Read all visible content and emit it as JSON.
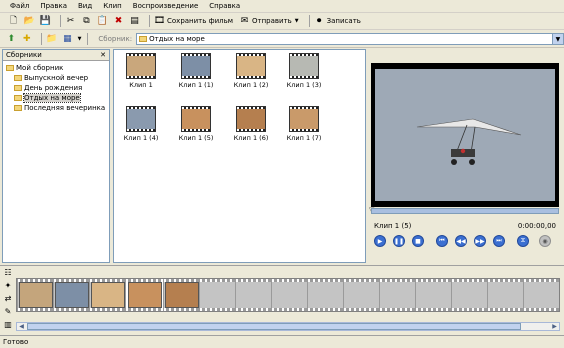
{
  "menu": [
    "Файл",
    "Правка",
    "Вид",
    "Клип",
    "Воспроизведение",
    "Справка"
  ],
  "toolbar": {
    "save_movie": "Сохранить фильм",
    "send": "Отправить",
    "record": "Записать"
  },
  "collections_bar": {
    "label": "Сборник:",
    "selected": "Отдых на море"
  },
  "left_panel": {
    "title": "Сборники",
    "close": "✕",
    "root": "Мой сборник",
    "items": [
      "Выпускной вечер",
      "День рождения",
      "Отдых на море",
      "Последняя вечеринка"
    ]
  },
  "clips": [
    {
      "label": "Клип 1",
      "color": "#c9a77c"
    },
    {
      "label": "Клип 1 (1)",
      "color": "#7d8fa6"
    },
    {
      "label": "Клип 1 (2)",
      "color": "#d9b585"
    },
    {
      "label": "Клип 1 (3)",
      "color": "#b7b9b3"
    },
    {
      "label": "Клип 1 (4)",
      "color": "#8a9aae"
    },
    {
      "label": "Клип 1 (5)",
      "color": "#c8915e"
    },
    {
      "label": "Клип 1 (6)",
      "color": "#b57f4f"
    },
    {
      "label": "Клип 1 (7)",
      "color": "#c99a6a"
    }
  ],
  "preview": {
    "title": "Клип 1 (5)",
    "time": "0:00:00,00"
  },
  "status": "Готово"
}
